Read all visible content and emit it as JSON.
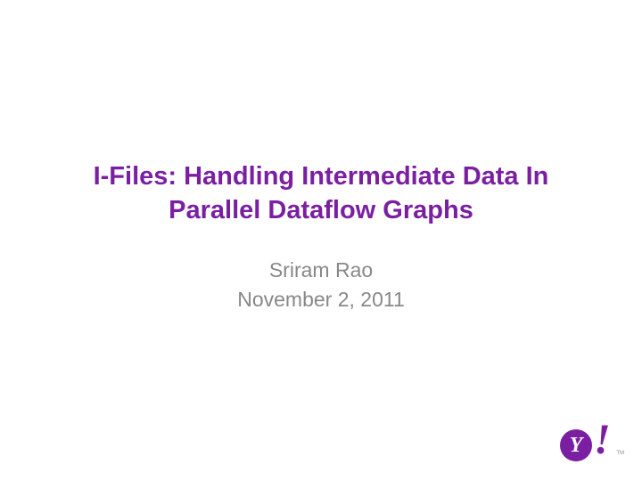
{
  "slide": {
    "title": "I-Files: Handling Intermediate Data In Parallel Dataflow Graphs",
    "author": "Sriram Rao",
    "date": "November 2, 2011"
  },
  "logo": {
    "letter": "Y",
    "exclaim": "!",
    "trademark": "TM"
  }
}
